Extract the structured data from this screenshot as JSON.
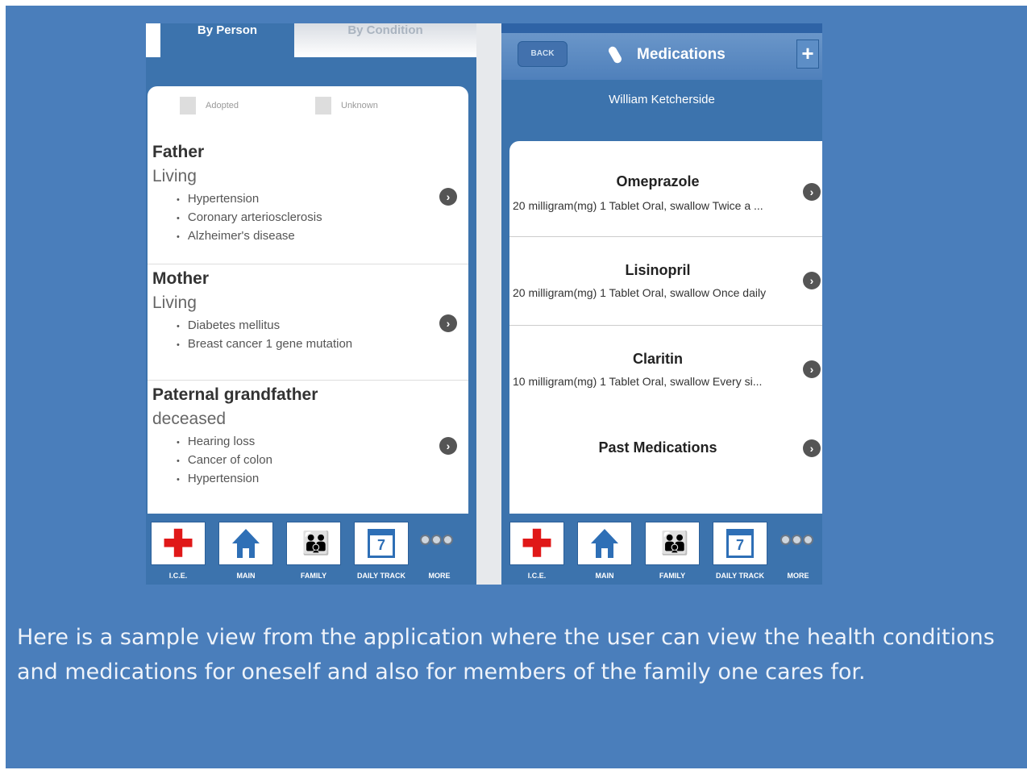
{
  "left_screen": {
    "tabs": [
      {
        "label": "By Person",
        "active": true
      },
      {
        "label": "By Condition",
        "active": false
      }
    ],
    "legend": [
      {
        "label": "Adopted"
      },
      {
        "label": "Unknown"
      }
    ],
    "members": [
      {
        "name": "Father",
        "status": "Living",
        "conditions": [
          "Hypertension",
          "Coronary arteriosclerosis",
          "Alzheimer's disease"
        ]
      },
      {
        "name": "Mother",
        "status": "Living",
        "conditions": [
          "Diabetes mellitus",
          "Breast cancer 1 gene mutation"
        ]
      },
      {
        "name": "Paternal grandfather",
        "status": "deceased",
        "conditions": [
          "Hearing loss",
          "Cancer of colon",
          "Hypertension"
        ]
      }
    ]
  },
  "right_screen": {
    "back_label": "BACK",
    "title": "Medications",
    "add_icon": "plus-icon",
    "patient_name": "William Ketcherside",
    "medications": [
      {
        "name": "Omeprazole",
        "detail": "20 milligram(mg) 1 Tablet Oral, swallow Twice a ..."
      },
      {
        "name": "Lisinopril",
        "detail": "20 milligram(mg) 1 Tablet Oral, swallow Once daily"
      },
      {
        "name": "Claritin",
        "detail": "10 milligram(mg) 1 Tablet Oral, swallow Every si..."
      }
    ],
    "past_label": "Past Medications"
  },
  "tabbar": {
    "items": [
      {
        "label": "I.C.E.",
        "icon": "red-cross-icon"
      },
      {
        "label": "MAIN",
        "icon": "house-icon"
      },
      {
        "label": "FAMILY",
        "icon": "family-icon"
      },
      {
        "label": "DAILY TRACK",
        "icon": "calendar-icon",
        "calendar_day": "7"
      },
      {
        "label": "MORE",
        "icon": "more-dots-icon"
      }
    ]
  },
  "caption": "Here  is a sample view from the  application where the  user can view the  health conditions and medications for oneself and also for members of  the family one cares for.",
  "colors": {
    "slide_bg": "#4a7ebb",
    "phone_blue": "#3c73ad",
    "cross_red": "#e01818"
  }
}
